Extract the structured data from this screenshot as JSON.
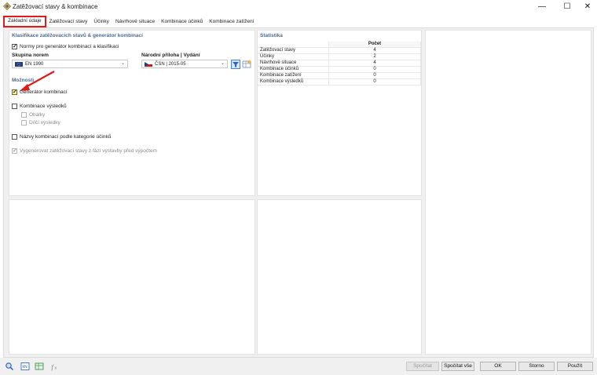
{
  "window": {
    "title": "Zatěžovací stavy & kombinace",
    "minimize": "—",
    "maximize": "☐",
    "close": "✕"
  },
  "tabs": [
    {
      "label": "Základní údaje",
      "active": true
    },
    {
      "label": "Zatěžovací stavy"
    },
    {
      "label": "Účinky"
    },
    {
      "label": "Návrhové situace"
    },
    {
      "label": "Kombinace účinků"
    },
    {
      "label": "Kombinace zatížení"
    }
  ],
  "classification": {
    "title": "Klasifikace zatěžovacích stavů & generátor kombinací",
    "standards_checkbox_label": "Normy pro generátor kombinací a klasifikaci",
    "standards_checked": true,
    "standard_group_label": "Skupina norem",
    "standard_group_value": "EN 1990",
    "national_annex_label": "Národní příloha | Vydání",
    "national_annex_value": "ČSN | 2015-05"
  },
  "options": {
    "title": "Možnosti",
    "generator_label": "Generátor kombinací",
    "generator_checked": true,
    "result_combos_label": "Kombinace výsledků",
    "result_combos_checked": false,
    "envelopes_label": "Obálky",
    "partial_results_label": "Dílčí výsledky",
    "combo_names_label": "Názvy kombinací podle kategorie účinků",
    "combo_names_checked": false,
    "generate_label": "Vygenerovat zatěžovací stavy z fází výstavby před výpočtem",
    "generate_checked": true
  },
  "statistics": {
    "title": "Statistika",
    "column": "Počet",
    "rows": [
      {
        "name": "Zatěžovací stavy",
        "value": "4"
      },
      {
        "name": "Účinky",
        "value": "2"
      },
      {
        "name": "Návrhové situace",
        "value": "4"
      },
      {
        "name": "Kombinace účinků",
        "value": "0"
      },
      {
        "name": "Kombinace zatížení",
        "value": "0"
      },
      {
        "name": "Kombinace výsledků",
        "value": "0"
      }
    ]
  },
  "buttons": {
    "calculate": "Spočítat",
    "calculate_all": "Spočítat vše",
    "ok": "OK",
    "cancel": "Storno",
    "apply": "Použít"
  },
  "colors": {
    "accent_red": "#e01b1b",
    "section_blue": "#4d6a8f"
  }
}
